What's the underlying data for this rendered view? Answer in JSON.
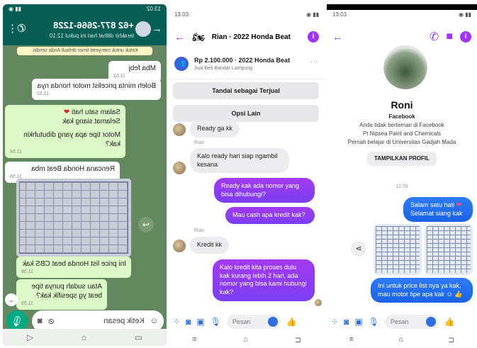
{
  "whatsapp": {
    "status_time": "13.02",
    "contact": "+62 877-2666-1228",
    "last_seen": "terakhir dilihat hari ini pukul 12.10",
    "system_note": "Ketuk untuk menyetel timer default Anda sendiri.",
    "messages": [
      {
        "text": "Mba febj",
        "time": "11.52"
      },
      {
        "text": "Boleh minta pricelist motor honda nya",
        "time": "11.52"
      },
      {
        "text": "Salam satu hati",
        "text2": "Selamat siang kak",
        "text3": "Motor tipe apa yang dibutuhkin kak?",
        "time": "11.54"
      },
      {
        "text": "Rencana Honda Beat mba",
        "time": "11.56"
      },
      {
        "text": "Ini price list Honda beat CBS kak",
        "time": "11.58"
      },
      {
        "text": "Atau sudah punya tipe beat yg spesifik kak?",
        "time": "11.59"
      }
    ],
    "input_placeholder": "Ketik pesan"
  },
  "messenger_chat": {
    "status_time": "13.03",
    "title": "Rian · 2022 Honda Beat",
    "listing_title": "Rp 2.100.000 · 2022 Honda Beat",
    "listing_sub": "Jual Beli Bandar Lampung",
    "btn_sold": "Tandai sebagai Terjual",
    "btn_other": "Opsi Lain",
    "sender": "Rian",
    "messages": [
      {
        "side": "in",
        "text": "Ready ga kk"
      },
      {
        "side": "in",
        "text": "Kalo ready hari siap ngambil kesana"
      },
      {
        "side": "out",
        "text": "Ready kak ada nomor yang bisa dihubungi?"
      },
      {
        "side": "out",
        "text": "Mau cash apa kredit kak?"
      },
      {
        "side": "in",
        "text": "Kredit kk"
      },
      {
        "side": "out",
        "text": "Kalo kredit kita proses dulu kak kurang lebih 2 hari, ada nomor yang bisa kami hubungi kak?"
      }
    ],
    "input_placeholder": "Pesan"
  },
  "messenger_profile": {
    "status_time": "13.03",
    "name": "Roni",
    "network": "Facebook",
    "info": [
      "Anda tidak berteman di Facebook",
      "Pt Nipsea Paint and Chemicals",
      "Pernah belajar di Universitas Gadjah Mada"
    ],
    "profile_button": "TAMPILKAN PROFIL",
    "timestamp": "12.59",
    "msg1_line1": "Salam satu hati",
    "msg1_line2": "Selamat siang kak",
    "msg2": "Ini untuk price list nya ya kak, mau motor tipe apa kak",
    "input_placeholder": "Pesan"
  }
}
